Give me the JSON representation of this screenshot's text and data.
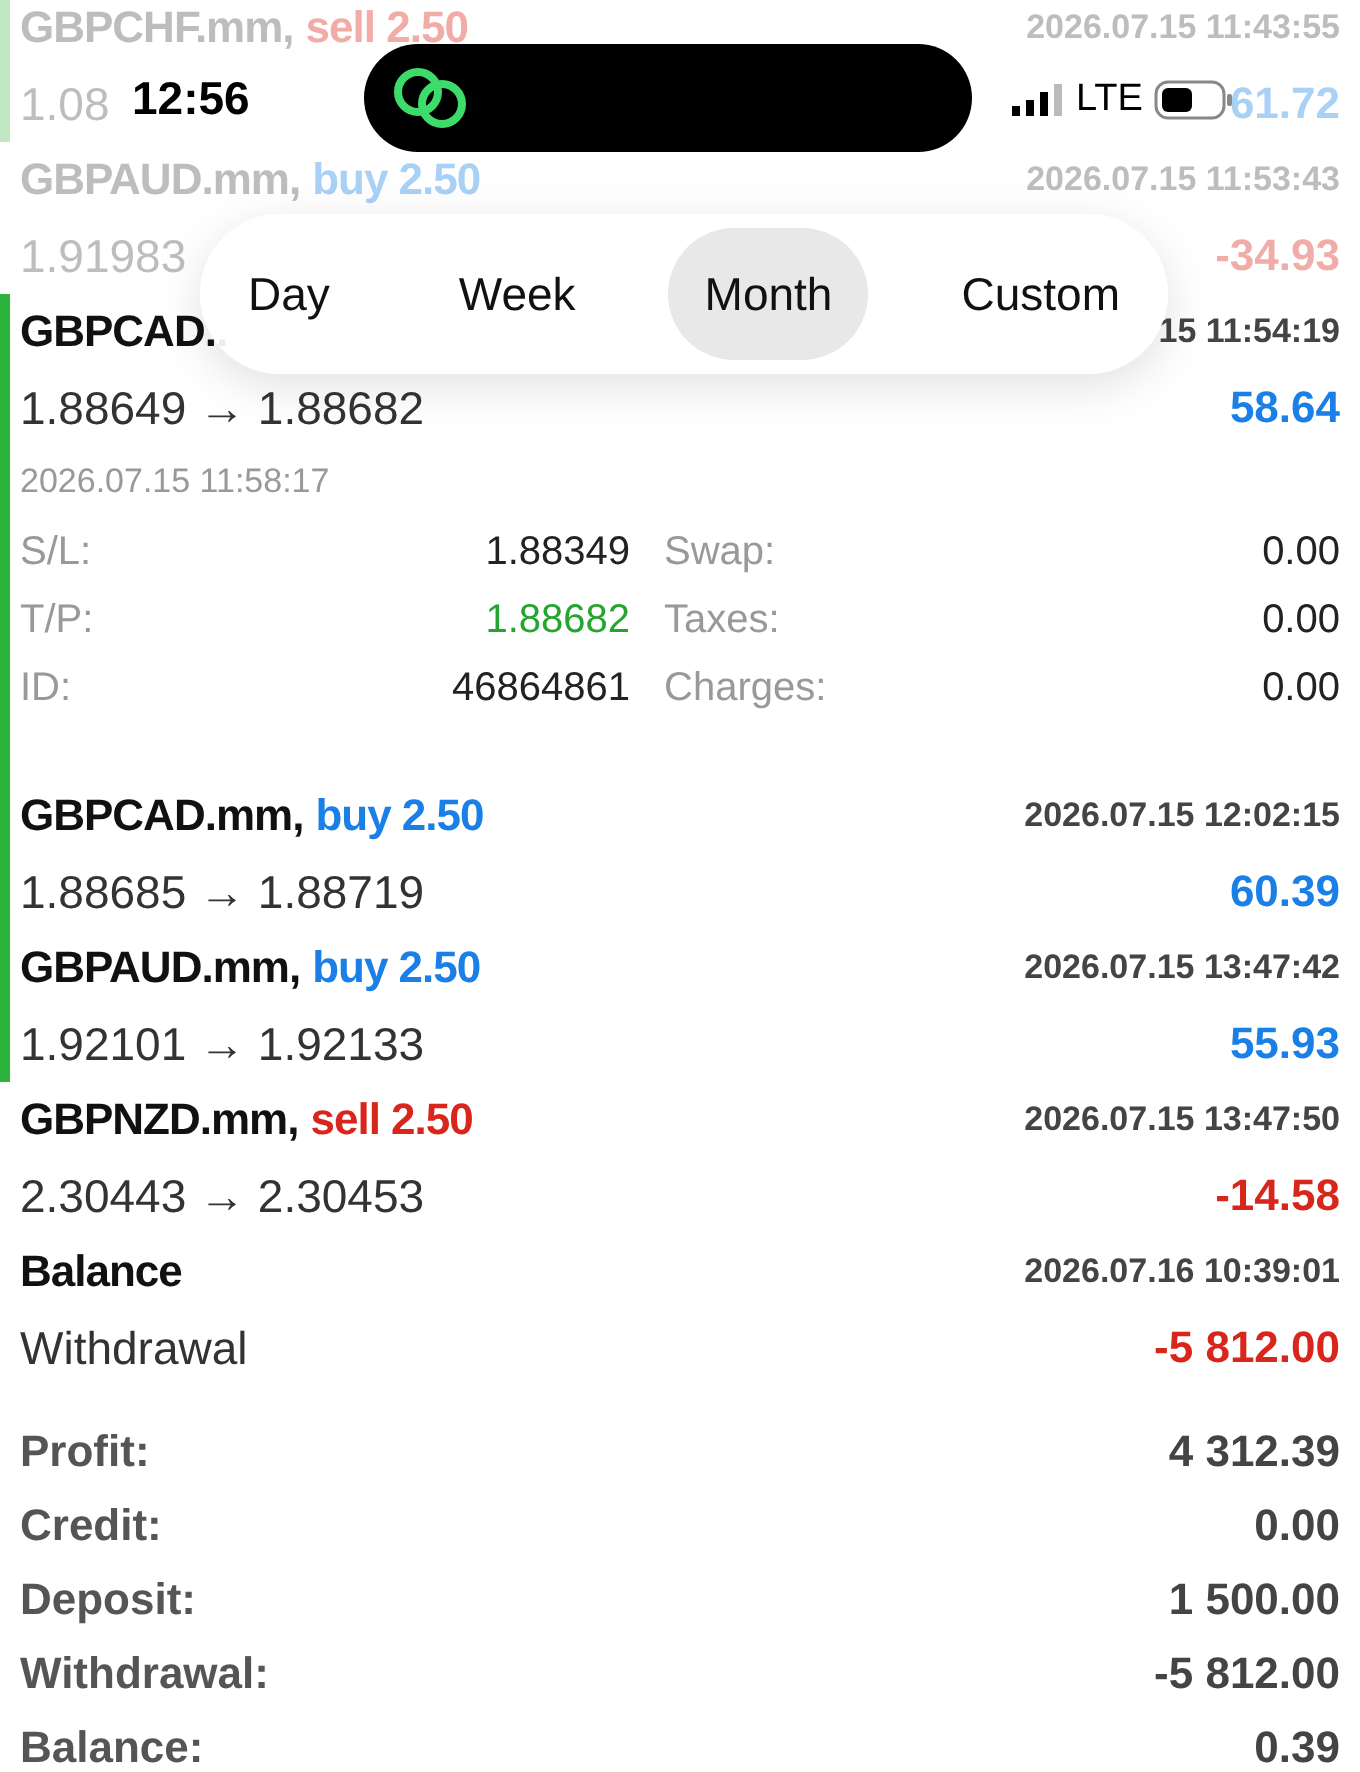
{
  "status_bar": {
    "time": "12:56",
    "network": "LTE"
  },
  "period_tabs": [
    {
      "label": "Day",
      "selected": false
    },
    {
      "label": "Week",
      "selected": false
    },
    {
      "label": "Month",
      "selected": true
    },
    {
      "label": "Custom",
      "selected": false
    }
  ],
  "deals": [
    {
      "symbol": "GBPCHF.mm,",
      "kind": "sell",
      "side": "sell 2.50",
      "time": "2026.07.15 11:43:55",
      "prices": "1.08",
      "profit": "61.72",
      "color": "#a9d0f5",
      "faded": true,
      "marked": true
    },
    {
      "symbol": "GBPAUD.mm,",
      "kind": "buy",
      "side": "buy 2.50",
      "time": "2026.07.15 11:53:43",
      "prices": "1.91983",
      "profit": "-34.93",
      "color": "#f2aca7",
      "faded": true,
      "marked": false
    },
    {
      "symbol": "GBPCAD..",
      "time": "15 11:54:19",
      "prices": "1.88649 → 1.88682",
      "profit": "58.64",
      "color": "#1a7fe6",
      "faded": false,
      "marked": true,
      "details": {
        "open_time": "2026.07.15 11:58:17",
        "fields": [
          {
            "label": "S/L:",
            "value": "1.88349",
            "kind": "plain"
          },
          {
            "label": "Swap:",
            "value": "0.00",
            "kind": "plain"
          },
          {
            "label": "T/P:",
            "value": "1.88682",
            "kind": "target"
          },
          {
            "label": "Taxes:",
            "value": "0.00",
            "kind": "plain"
          },
          {
            "label": "ID:",
            "value": "46864861",
            "kind": "plain"
          },
          {
            "label": "Charges:",
            "value": "0.00",
            "kind": "plain"
          }
        ]
      }
    },
    {
      "symbol": "GBPCAD.mm,",
      "kind": "buy",
      "side": "buy 2.50",
      "time": "2026.07.15 12:02:15",
      "prices": "1.88685 → 1.88719",
      "profit": "60.39",
      "color": "#1a7fe6",
      "faded": false,
      "marked": true
    },
    {
      "symbol": "GBPAUD.mm,",
      "kind": "buy",
      "side": "buy 2.50",
      "time": "2026.07.15 13:47:42",
      "prices": "1.92101 → 1.92133",
      "profit": "55.93",
      "color": "#1a7fe6",
      "faded": false,
      "marked": true
    },
    {
      "symbol": "GBPNZD.mm,",
      "kind": "sell",
      "side": "sell 2.50",
      "time": "2026.07.15 13:47:50",
      "prices": "2.30443 → 2.30453",
      "profit": "-14.58",
      "color": "#d9261c",
      "faded": false,
      "marked": false
    }
  ],
  "balance_entry": {
    "title": "Balance",
    "time": "2026.07.16 10:39:01",
    "comment": "Withdrawal",
    "amount": "-5 812.00",
    "color": "#d9261c"
  },
  "summary": [
    {
      "label": "Profit:",
      "value": "4 312.39"
    },
    {
      "label": "Credit:",
      "value": "0.00"
    },
    {
      "label": "Deposit:",
      "value": "1 500.00"
    },
    {
      "label": "Withdrawal:",
      "value": "-5 812.00"
    },
    {
      "label": "Balance:",
      "value": "0.39"
    }
  ]
}
